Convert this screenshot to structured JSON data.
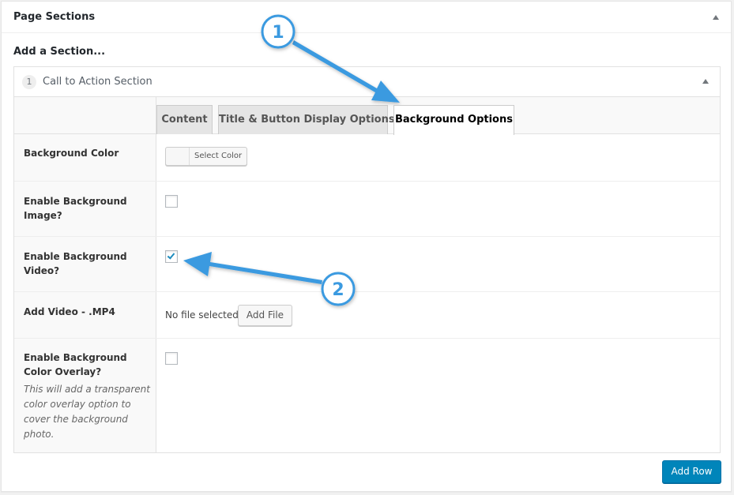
{
  "postbox": {
    "title": "Page Sections",
    "toggle_icon": "triangle-up-icon"
  },
  "add_section_label": "Add a Section...",
  "section": {
    "number": "1",
    "name": "Call to Action Section",
    "toggle_icon": "triangle-up-icon"
  },
  "tabs": [
    {
      "label": "Content",
      "active": false
    },
    {
      "label": "Title & Button Display Options",
      "active": false
    },
    {
      "label": "Background Options",
      "active": true
    }
  ],
  "fields": {
    "background_color": {
      "label": "Background Color",
      "button_label": "Select Color"
    },
    "enable_bg_image": {
      "label": "Enable Background Image?",
      "checked": false
    },
    "enable_bg_video": {
      "label": "Enable Background Video?",
      "checked": true
    },
    "add_video": {
      "label": "Add Video - .MP4",
      "status": "No file selected",
      "button_label": "Add File"
    },
    "enable_color_overlay": {
      "label": "Enable Background Color Overlay?",
      "description": "This will add a transparent color overlay option to cover the background photo.",
      "checked": false
    }
  },
  "add_row_label": "Add Row",
  "callouts": [
    {
      "number": "1"
    },
    {
      "number": "2"
    }
  ],
  "colors": {
    "accent": "#0085ba",
    "callout": "#3a9ae0",
    "checkmark": "#1e8cbe"
  }
}
